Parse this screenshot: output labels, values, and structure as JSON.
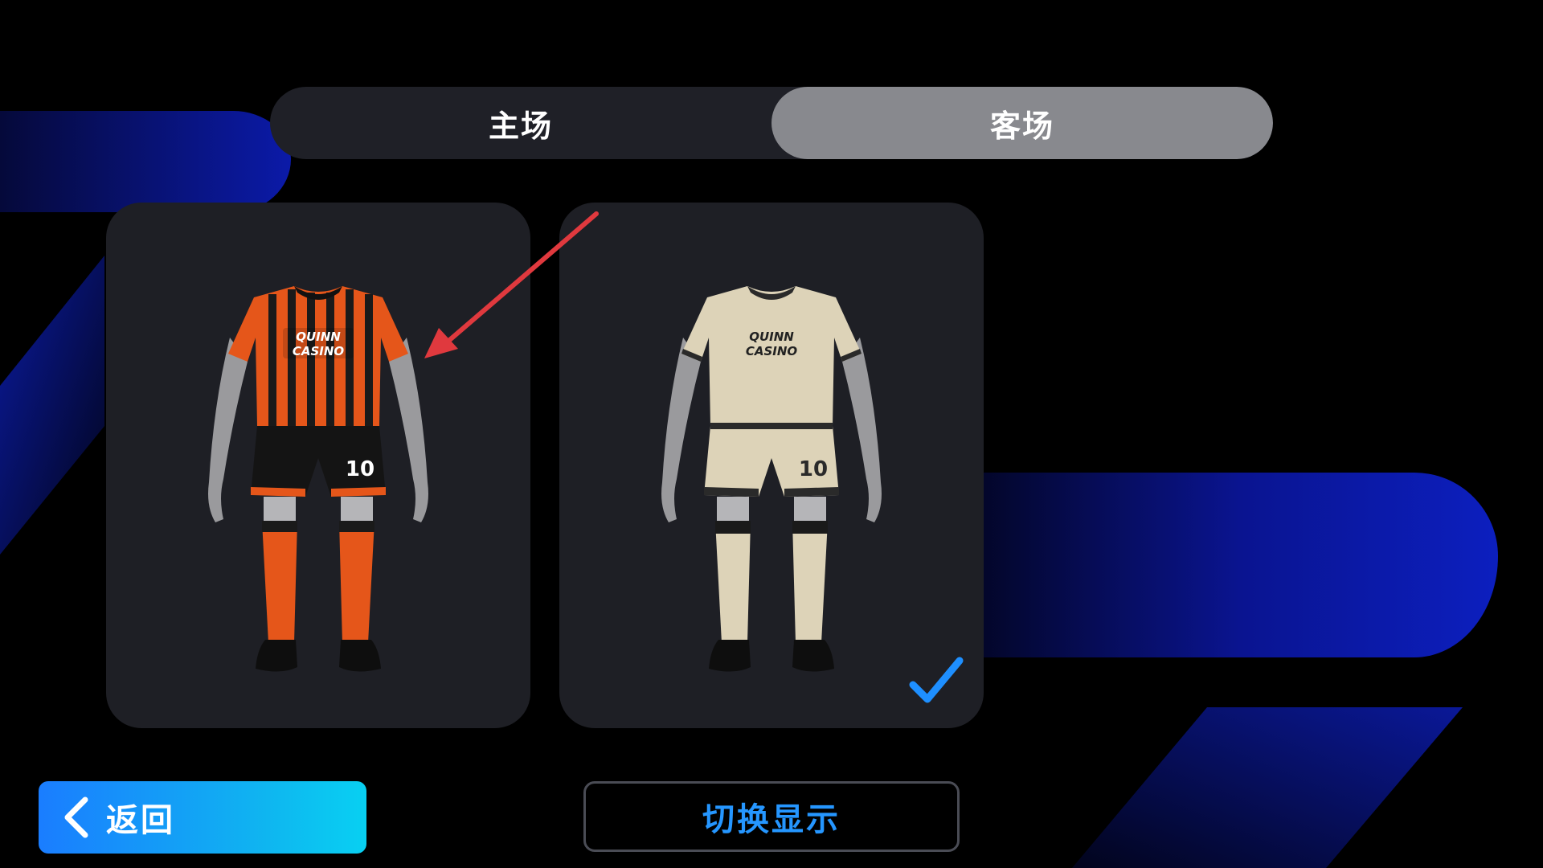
{
  "tabs": [
    {
      "label": "主场",
      "active": false
    },
    {
      "label": "客场",
      "active": true
    }
  ],
  "kits": {
    "home": {
      "sponsor_line1": "QUINN",
      "sponsor_line2": "CASINO",
      "number": "10",
      "shirt_color": "#e5561a",
      "stripe_color": "#1a1a1a",
      "shorts_color": "#141414",
      "socks_color": "#e5561a",
      "selected": false
    },
    "away": {
      "sponsor_line1": "QUINN",
      "sponsor_line2": "CASINO",
      "number": "10",
      "shirt_color": "#ddd3b8",
      "stripe_color": "#2a2a2a",
      "shorts_color": "#ddd3b8",
      "socks_color": "#ddd3b8",
      "selected": true
    }
  },
  "buttons": {
    "back_label": "返回",
    "toggle_label": "切换显示"
  },
  "colors": {
    "accent_blue": "#1a8cff",
    "check_blue": "#1e8fff",
    "annotation_red": "#e0393e"
  },
  "icons": {
    "back": "chevron-left-icon",
    "selected": "check-icon"
  }
}
